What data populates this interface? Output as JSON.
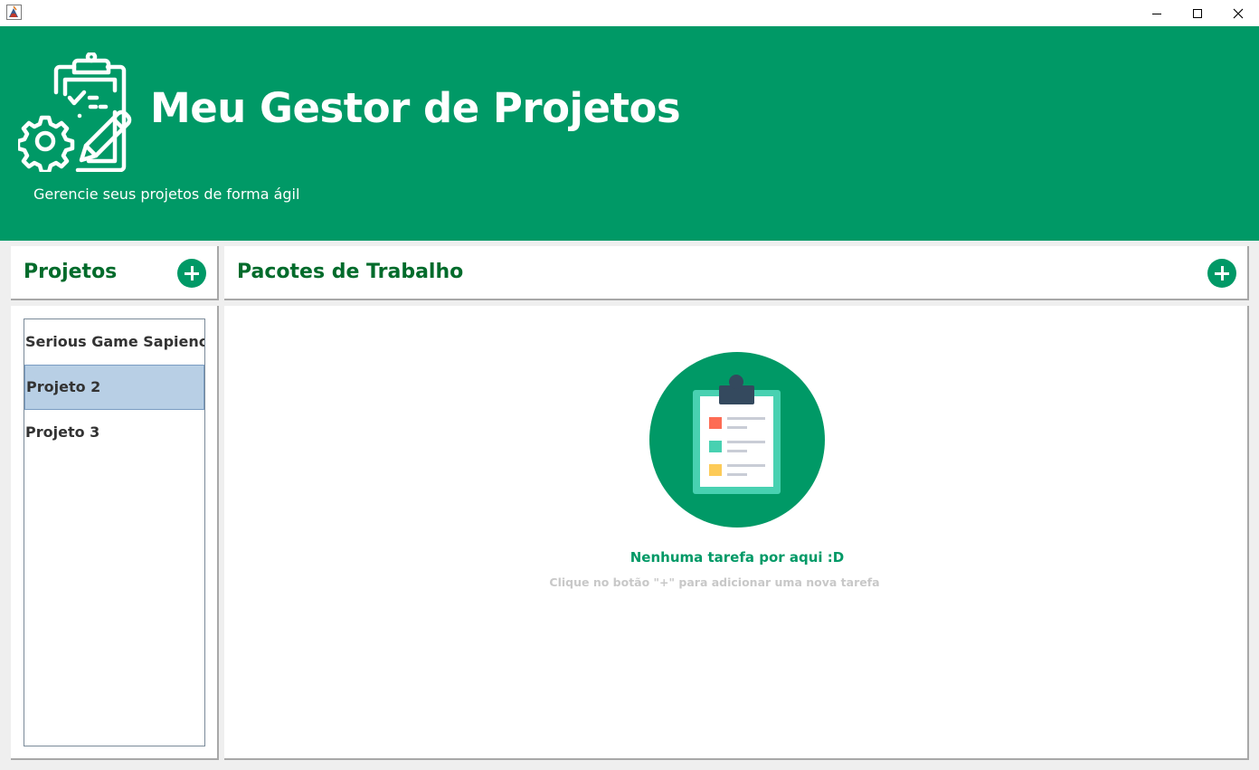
{
  "window": {
    "icon": "java-cup-icon",
    "controls": [
      "minimize-icon",
      "maximize-icon",
      "close-icon"
    ]
  },
  "header": {
    "title": "Meu Gestor de Projetos",
    "subtitle": "Gerencie seus projetos de forma ágil",
    "logo_icon": "clipboard-gear-pencil-icon",
    "background_color": "#009966"
  },
  "projects_panel": {
    "title": "Projetos",
    "add_icon": "plus-circle-icon",
    "items": [
      {
        "label": "Serious Game Sapience",
        "selected": false
      },
      {
        "label": "Projeto 2",
        "selected": true
      },
      {
        "label": "Projeto 3",
        "selected": false
      }
    ]
  },
  "work_packages_panel": {
    "title": "Pacotes de Trabalho",
    "add_icon": "plus-circle-icon",
    "empty_state": {
      "icon": "clipboard-checklist-icon",
      "title": "Nenhuma tarefa por aqui  :D",
      "hint": "Clique no botão \"+\" para adicionar uma nova tarefa"
    }
  },
  "colors": {
    "accent": "#009966",
    "panel_title": "#006b2b",
    "selection": "#b8cfe5",
    "hint_text": "#c8c8c8"
  }
}
